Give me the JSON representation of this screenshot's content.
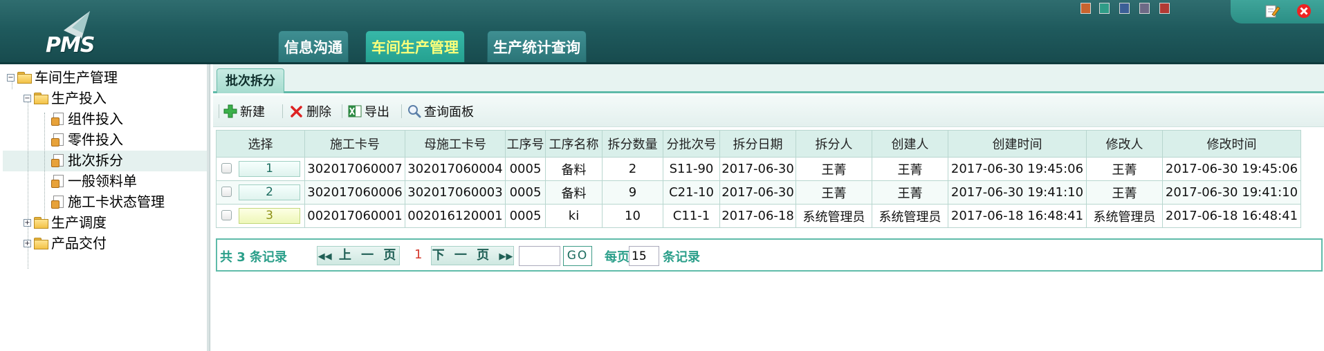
{
  "app": {
    "logo_text": "PMS",
    "nav_tabs": [
      {
        "label": "信息沟通",
        "active": false
      },
      {
        "label": "车间生产管理",
        "active": true
      },
      {
        "label": "生产统计查询",
        "active": false
      }
    ],
    "theme_swatches": [
      "#c8642f",
      "#2f9c87",
      "#3b5f96",
      "#6d6a86",
      "#b13a34"
    ]
  },
  "sidebar": {
    "root": "车间生产管理",
    "groups": [
      {
        "label": "生产投入",
        "expanded": true,
        "items": [
          "组件投入",
          "零件投入",
          "批次拆分",
          "一般领料单",
          "施工卡状态管理"
        ]
      },
      {
        "label": "生产调度",
        "expanded": false
      },
      {
        "label": "产品交付",
        "expanded": false
      }
    ],
    "selected": "批次拆分"
  },
  "page": {
    "tab_title": "批次拆分",
    "toolbar": {
      "new_label": "新建",
      "delete_label": "删除",
      "export_label": "导出",
      "query_label": "查询面板"
    },
    "table": {
      "columns": [
        "选择",
        "施工卡号",
        "母施工卡号",
        "工序号",
        "工序名称",
        "拆分数量",
        "分批次号",
        "拆分日期",
        "拆分人",
        "创建人",
        "创建时间",
        "修改人",
        "修改时间"
      ],
      "rows": [
        [
          "1",
          "302017060007",
          "302017060004",
          "0005",
          "备料",
          "2",
          "S11-90",
          "2017-06-30",
          "王菁",
          "王菁",
          "2017-06-30 19:45:06",
          "王菁",
          "2017-06-30 19:45:06"
        ],
        [
          "2",
          "302017060006",
          "302017060003",
          "0005",
          "备料",
          "9",
          "C21-10",
          "2017-06-30",
          "王菁",
          "王菁",
          "2017-06-30 19:41:10",
          "王菁",
          "2017-06-30 19:41:10"
        ],
        [
          "3",
          "002017060001",
          "002016120001",
          "0005",
          "ki",
          "10",
          "C11-1",
          "2017-06-18",
          "系统管理员",
          "系统管理员",
          "2017-06-18 16:48:41",
          "系统管理员",
          "2017-06-18 16:48:41"
        ]
      ],
      "active_row": 2
    },
    "pager": {
      "total_text": "共 3 条记录",
      "prev_label": "上 一 页",
      "current_page": "1",
      "next_label": "下 一 页",
      "jump_value": "",
      "go_label": "GO",
      "per_page_prefix": "每页",
      "per_page_value": "15",
      "per_page_suffix": "条记录"
    }
  }
}
